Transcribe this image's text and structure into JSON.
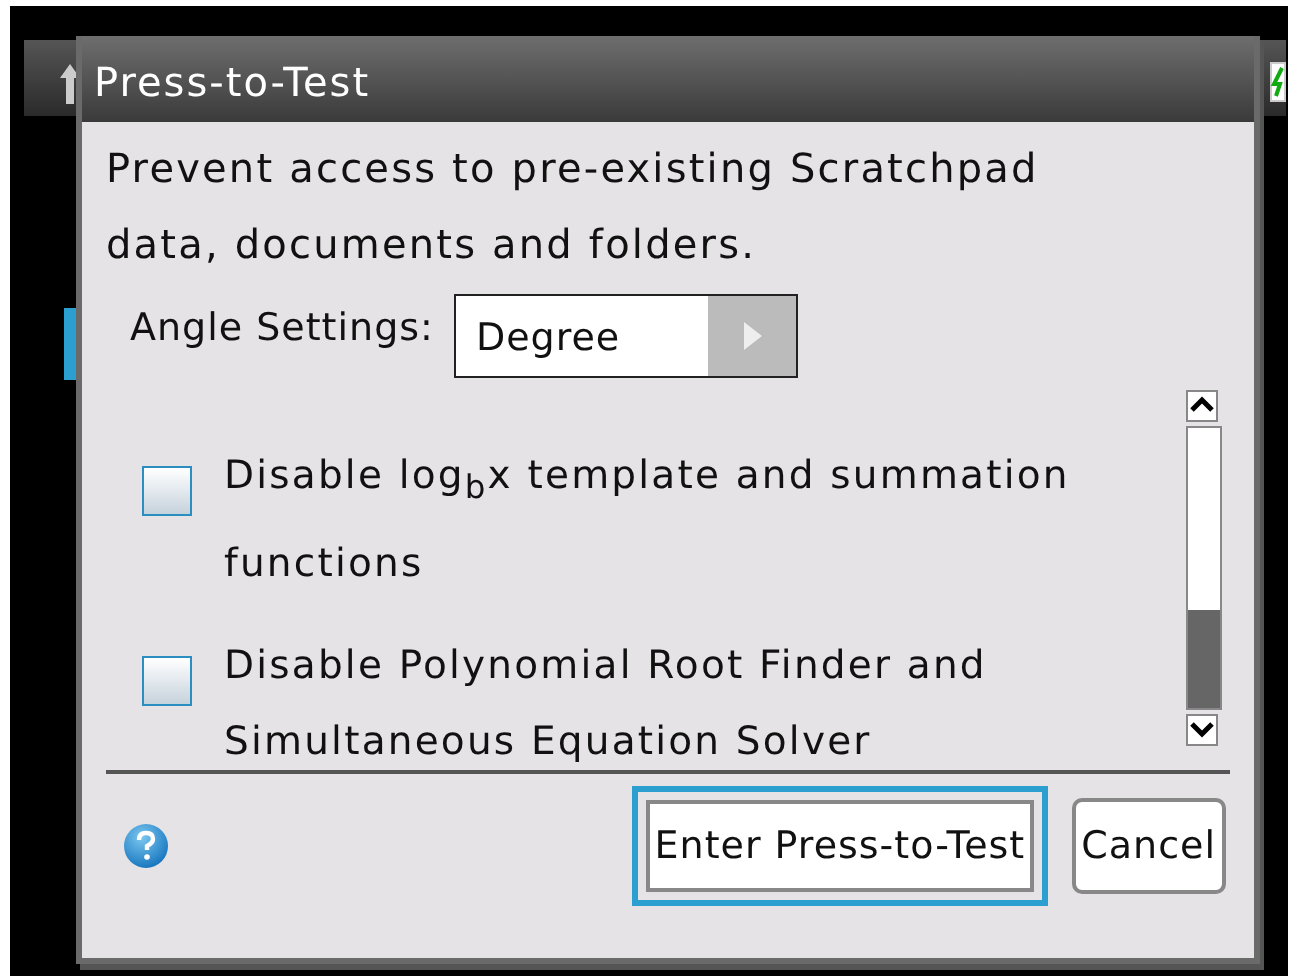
{
  "dialog": {
    "title": "Press-to-Test",
    "message": "Prevent access to pre-existing Scratchpad data, documents and folders.",
    "angle_setting": {
      "label": "Angle Settings:",
      "value": "Degree"
    },
    "options": [
      {
        "label": "Disable log$_{b}$x template and summation functions",
        "checked": false
      },
      {
        "label": "Disable Polynomial Root Finder and Simultaneous Equation Solver",
        "checked": false
      }
    ],
    "buttons": [
      {
        "label": "Enter Press-to-Test",
        "selected": true
      },
      {
        "label": "Cancel",
        "selected": false
      }
    ]
  }
}
